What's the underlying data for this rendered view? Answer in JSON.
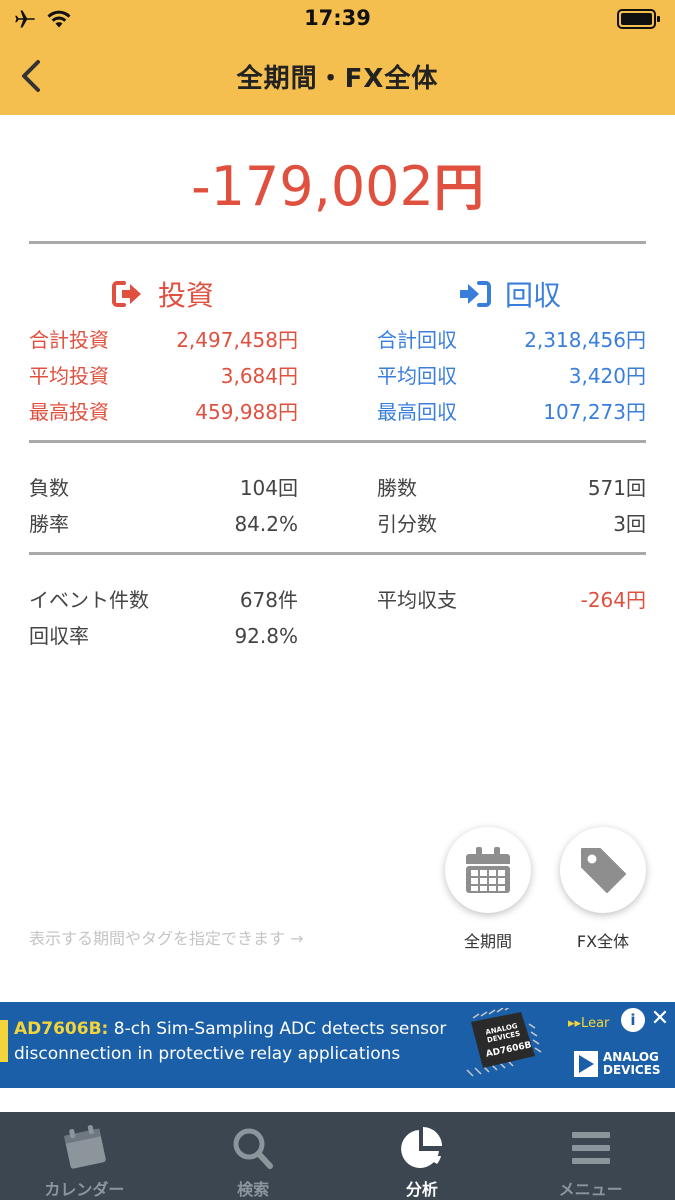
{
  "status_bar": {
    "time": "17:39"
  },
  "nav": {
    "title": "全期間・FX全体"
  },
  "summary": {
    "total_amount": "-179,002",
    "total_unit": "円"
  },
  "invest": {
    "header": "投資",
    "rows": [
      {
        "label": "合計投資",
        "value": "2,497,458円"
      },
      {
        "label": "平均投資",
        "value": "3,684円"
      },
      {
        "label": "最高投資",
        "value": "459,988円"
      }
    ]
  },
  "collect": {
    "header": "回収",
    "rows": [
      {
        "label": "合計回収",
        "value": "2,318,456円"
      },
      {
        "label": "平均回収",
        "value": "3,420円"
      },
      {
        "label": "最高回収",
        "value": "107,273円"
      }
    ]
  },
  "record": {
    "losses_label": "負数",
    "losses_value": "104回",
    "wins_label": "勝数",
    "wins_value": "571回",
    "win_rate_label": "勝率",
    "win_rate_value": "84.2%",
    "draws_label": "引分数",
    "draws_value": "3回"
  },
  "events": {
    "count_label": "イベント件数",
    "count_value": "678件",
    "avg_balance_label": "平均収支",
    "avg_balance_value": "-264円",
    "return_rate_label": "回収率",
    "return_rate_value": "92.8%"
  },
  "filters": {
    "hint": "表示する期間やタグを指定できます →",
    "period_label": "全期間",
    "tag_label": "FX全体"
  },
  "ad": {
    "headline_bold": "AD7606B:",
    "headline_rest": " 8-ch Sim-Sampling ADC detects sensor",
    "line2": "disconnection in protective relay applications",
    "cta": "▸▸Lear",
    "brand_line1": "ANALOG",
    "brand_line2": "DEVICES",
    "chip_line1": "ANALOG",
    "chip_line2": "DEVICES",
    "chip_model": "AD7606B"
  },
  "tabs": [
    {
      "label": "カレンダー",
      "icon": "calendar-icon",
      "active": false
    },
    {
      "label": "検索",
      "icon": "search-icon",
      "active": false
    },
    {
      "label": "分析",
      "icon": "pie-chart-icon",
      "active": true
    },
    {
      "label": "メニュー",
      "icon": "menu-icon",
      "active": false
    }
  ],
  "colors": {
    "header": "#F4BF4E",
    "negative": "#E0503F",
    "positive": "#3A7EDB",
    "tabbar": "#3B4650"
  }
}
